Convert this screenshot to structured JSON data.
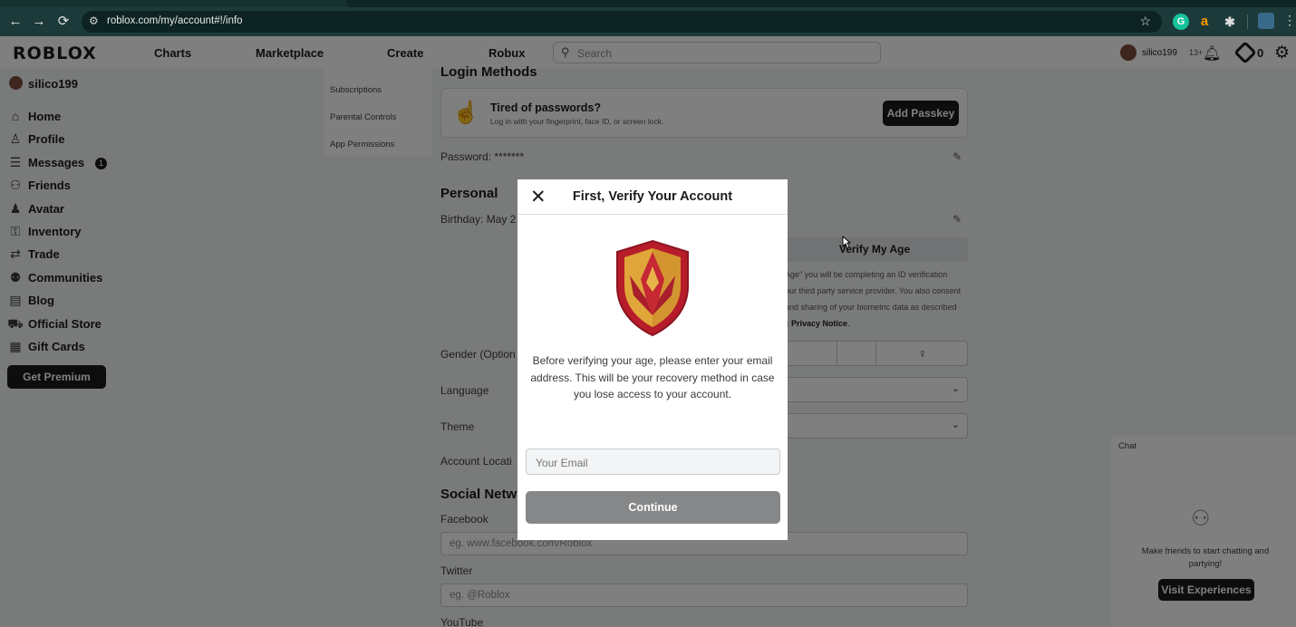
{
  "browser": {
    "url": "roblox.com/my/account#!/info",
    "back_icon": "←",
    "forward_icon": "→",
    "reload_icon": "⟳",
    "extension_g": "G",
    "extension_a": "a"
  },
  "topnav": {
    "logo": "ROBLOX",
    "links": [
      "Charts",
      "Marketplace",
      "Create",
      "Robux"
    ],
    "search_placeholder": "Search",
    "username": "silico199",
    "age_badge": "13+",
    "robux": "0"
  },
  "sidebar": {
    "username": "silico199",
    "items": [
      {
        "label": "Home",
        "icon": "home-icon"
      },
      {
        "label": "Profile",
        "icon": "profile-icon"
      },
      {
        "label": "Messages",
        "icon": "messages-icon"
      },
      {
        "label": "Friends",
        "icon": "friends-icon"
      },
      {
        "label": "Avatar",
        "icon": "avatar-icon"
      },
      {
        "label": "Inventory",
        "icon": "inventory-icon"
      },
      {
        "label": "Trade",
        "icon": "trade-icon"
      },
      {
        "label": "Communities",
        "icon": "communities-icon"
      },
      {
        "label": "Blog",
        "icon": "blog-icon"
      },
      {
        "label": "Official Store",
        "icon": "store-icon"
      },
      {
        "label": "Gift Cards",
        "icon": "gift-card-icon"
      }
    ],
    "messages_badge": "1",
    "premium_button": "Get Premium"
  },
  "settings_nav": {
    "items": [
      "Subscriptions",
      "Parental Controls",
      "App Permissions"
    ]
  },
  "content": {
    "login_methods_title": "Login Methods",
    "passkey_title": "Tired of passwords?",
    "passkey_sub": "Log in with your fingerprint, face ID, or screen lock.",
    "add_passkey": "Add Passkey",
    "password_label": "Password: *******",
    "personal_title": "Personal",
    "birthday_label": "Birthday: May 2",
    "verify_age_button": "Verify My Age",
    "verify_text_1": "Age\" you will be completing an ID verification",
    "verify_text_2": "our third party service provider. You also consent",
    "verify_text_3": "and sharing of your biometric data as described",
    "verify_text_4_prefix": "c",
    "privacy_notice": "Privacy Notice",
    "gender_label": "Gender (Option",
    "language_label": "Language",
    "theme_label": "Theme",
    "account_location_label": "Account Locati",
    "social_title": "Social Netw",
    "facebook_label": "Facebook",
    "facebook_placeholder": "eg. www.facebook.com/Roblox",
    "twitter_label": "Twitter",
    "twitter_placeholder": "eg. @Roblox",
    "youtube_label": "YouTube"
  },
  "chat": {
    "title": "Chat",
    "message": "Make friends to start chatting and partying!",
    "button": "Visit Experiences"
  },
  "modal": {
    "title": "First, Verify Your Account",
    "description": "Before verifying your age, please enter your email address. This will be your recovery method in case you lose access to your account.",
    "email_placeholder": "Your Email",
    "continue_button": "Continue"
  }
}
